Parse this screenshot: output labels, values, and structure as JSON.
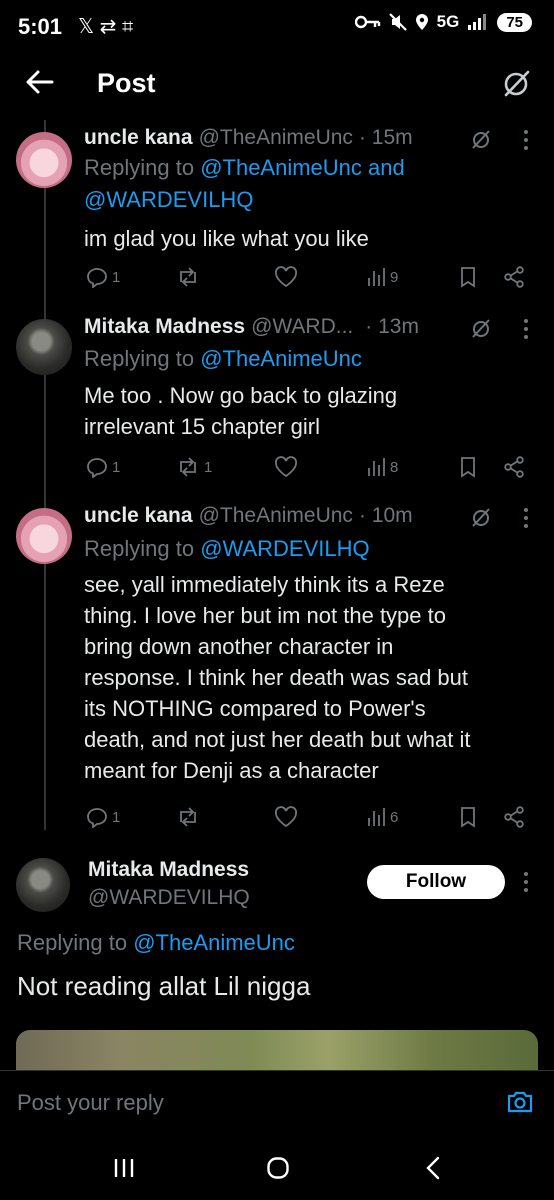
{
  "status_bar": {
    "time": "5:01",
    "left_icons": "𝕏 ⇄ ⌗",
    "network": "5G",
    "battery": "75"
  },
  "header": {
    "title": "Post"
  },
  "posts": [
    {
      "name": "uncle kana",
      "handle": "@TheAnimeUnc",
      "time": "· 15m",
      "replying_prefix": "Replying to ",
      "replying_to_1": "@TheAnimeUnc and",
      "replying_to_2": "@WARDEVILHQ",
      "text_lines": [
        "im glad you like what you like"
      ],
      "replies": "1",
      "reposts": "",
      "views": "9"
    },
    {
      "name": "Mitaka Madness",
      "handle": "@WARD...",
      "time": "· 13m",
      "replying_prefix": "Replying to ",
      "replying_to_1": "@TheAnimeUnc",
      "text_lines": [
        "Me too . Now go back to glazing",
        "irrelevant 15 chapter girl"
      ],
      "replies": "1",
      "reposts": "1",
      "views": "8"
    },
    {
      "name": "uncle kana",
      "handle": "@TheAnimeUnc",
      "time": "· 10m",
      "replying_prefix": "Replying to ",
      "replying_to_1": "@WARDEVILHQ",
      "text_lines": [
        "see, yall immediately think its a Reze",
        "thing. I love her but im not the type to",
        "bring down another character in",
        "response. I think her death was sad but",
        "its NOTHING compared to Power's",
        "death, and not just her death but what it",
        "meant for Denji as a character"
      ],
      "replies": "1",
      "reposts": "",
      "views": "6"
    }
  ],
  "focused_post": {
    "name": "Mitaka Madness",
    "handle": "@WARDEVILHQ",
    "follow_label": "Follow",
    "replying_prefix": "Replying to ",
    "replying_to": "@TheAnimeUnc",
    "text": "Not reading allat Lil nigga"
  },
  "reply_bar": {
    "placeholder": "Post your reply"
  },
  "colors": {
    "accent": "#1d9bf0",
    "muted": "#71767b",
    "text": "#e7e9ea",
    "background": "#000000"
  }
}
